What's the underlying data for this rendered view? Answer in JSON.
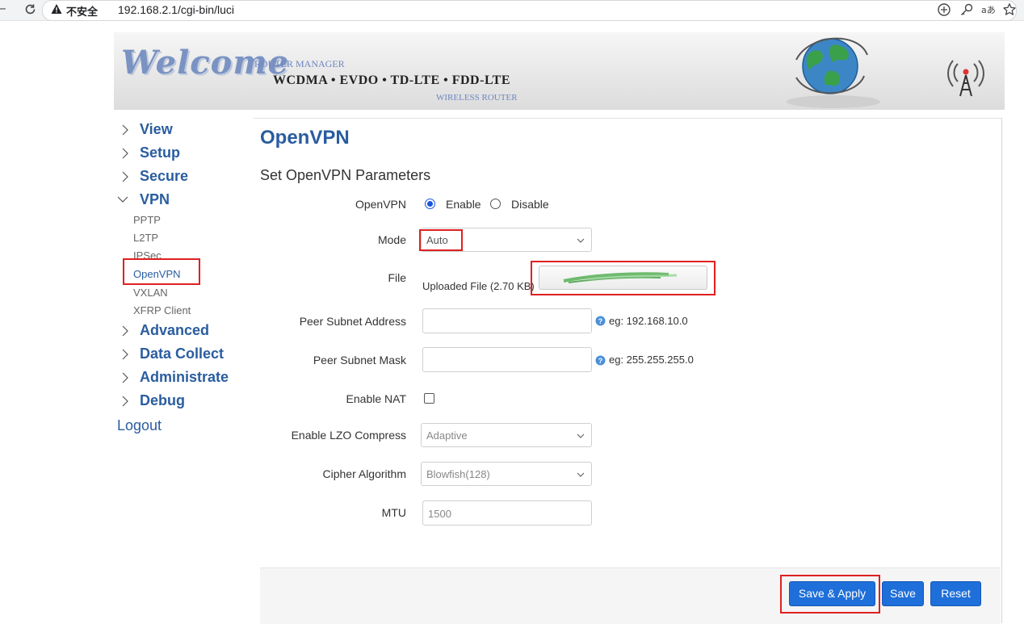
{
  "browser": {
    "security_label": "不安全",
    "url": "192.168.2.1/cgi-bin/luci"
  },
  "banner": {
    "welcome": "Welcome",
    "manager": "ROUTER MANAGER",
    "tech": "WCDMA • EVDO • TD-LTE • FDD-LTE",
    "subtitle": "WIRELESS ROUTER"
  },
  "sidebar": {
    "items": [
      {
        "label": "View"
      },
      {
        "label": "Setup"
      },
      {
        "label": "Secure"
      },
      {
        "label": "VPN",
        "expanded": true
      },
      {
        "label": "Advanced"
      },
      {
        "label": "Data Collect"
      },
      {
        "label": "Administrate"
      },
      {
        "label": "Debug"
      }
    ],
    "vpn_children": [
      "PPTP",
      "L2TP",
      "IPSec",
      "OpenVPN",
      "VXLAN",
      "XFRP Client"
    ],
    "selected": "OpenVPN",
    "logout": "Logout"
  },
  "main": {
    "title": "OpenVPN",
    "section": "Set OpenVPN Parameters",
    "fields": {
      "openvpn": {
        "label": "OpenVPN",
        "options": [
          "Enable",
          "Disable"
        ],
        "selected": "Enable"
      },
      "mode": {
        "label": "Mode",
        "value": "Auto"
      },
      "file": {
        "label": "File",
        "status": "Uploaded File (2.70 KB)"
      },
      "peer_subnet_address": {
        "label": "Peer Subnet Address",
        "value": "",
        "hint": "eg: 192.168.10.0"
      },
      "peer_subnet_mask": {
        "label": "Peer Subnet Mask",
        "value": "",
        "hint": "eg: 255.255.255.0"
      },
      "enable_nat": {
        "label": "Enable NAT",
        "checked": false
      },
      "lzo": {
        "label": "Enable LZO Compress",
        "value": "Adaptive"
      },
      "cipher": {
        "label": "Cipher Algorithm",
        "value": "Blowfish(128)"
      },
      "mtu": {
        "label": "MTU",
        "value": "1500"
      }
    }
  },
  "footer": {
    "save_apply": "Save & Apply",
    "save": "Save",
    "reset": "Reset"
  },
  "colors": {
    "nav_blue": "#2a5d9f",
    "button_blue": "#1e6fd9",
    "highlight_red": "#e02020"
  }
}
